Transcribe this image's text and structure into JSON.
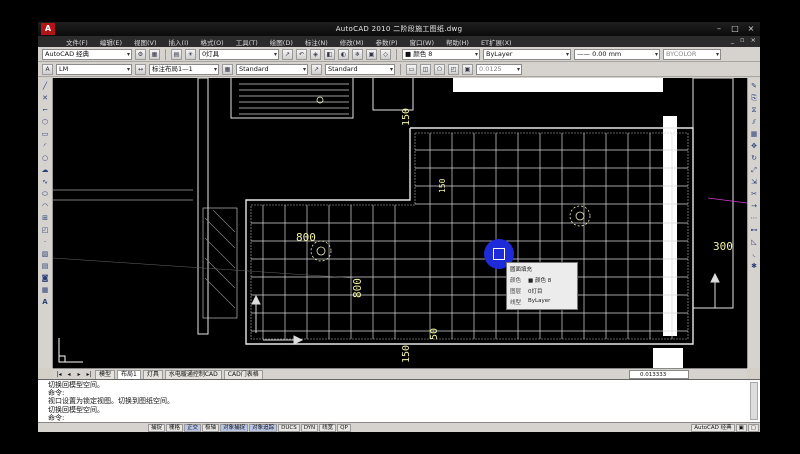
{
  "app": {
    "title": "AutoCAD 2010     二阶段施工图纸.dwg",
    "logo": "A"
  },
  "menu": [
    "文件(F)",
    "编辑(E)",
    "视图(V)",
    "插入(I)",
    "格式(O)",
    "工具(T)",
    "绘图(D)",
    "标注(N)",
    "修改(M)",
    "参数(P)",
    "窗口(W)",
    "帮助(H)",
    "ET扩展(X)"
  ],
  "toolbar1": {
    "workspace": "AutoCAD 经典",
    "layer": "0灯具",
    "color": "■ 颜色 8",
    "linetype": "ByLayer",
    "lineweight": "—— 0.00 mm",
    "plotstyle": "BYCOLOR"
  },
  "toolbar2": {
    "text_style": "LM",
    "dim_style": "标注布局1—1",
    "table_style": "Standard",
    "ml_style": "Standard",
    "scale_value": "0.0125"
  },
  "drawing": {
    "dims": [
      "800",
      "800",
      "150",
      "150",
      "150",
      "50",
      "300"
    ]
  },
  "tooltip": {
    "title": "圆面填充",
    "rows": [
      {
        "k": "颜色",
        "v": "■ 颜色 8"
      },
      {
        "k": "图层",
        "v": "0灯目"
      },
      {
        "k": "线型",
        "v": "ByLayer"
      }
    ]
  },
  "tabs": [
    "模型",
    "布局1",
    "灯具",
    "水电暖通控制CAD",
    "CAD门表格"
  ],
  "coordinate": "0.013333",
  "command_lines": [
    "切换回模型空间。",
    "命令:",
    "视口设置为锁定视图。切换到图纸空间。",
    "切换回模型空间。",
    "命令:"
  ],
  "status_buttons": [
    "捕捉",
    "栅格",
    "正交",
    "极轴",
    "对象捕捉",
    "对象追踪",
    "DUCS",
    "DYN",
    "线宽",
    "QP"
  ],
  "status_on": [
    false,
    false,
    true,
    false,
    true,
    true,
    false,
    false,
    false,
    false
  ],
  "workspace_status": "AutoCAD 经典"
}
